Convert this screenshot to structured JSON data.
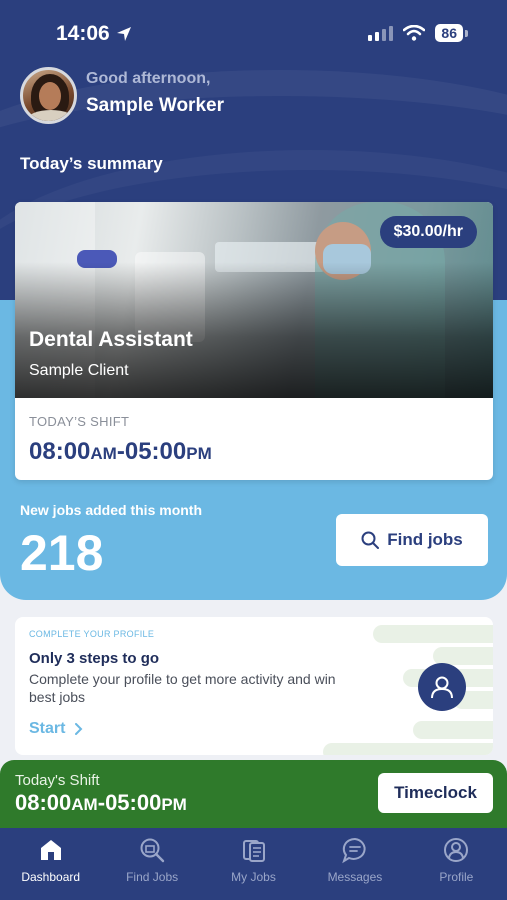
{
  "status_bar": {
    "time": "14:06",
    "battery": "86"
  },
  "header": {
    "greeting": "Good afternoon,",
    "user_name": "Sample Worker",
    "summary_title": "Today’s summary"
  },
  "job_card": {
    "rate": "$30.00/hr",
    "title": "Dental Assistant",
    "client": "Sample Client",
    "shift_label": "TODAY’S SHIFT",
    "shift_start": "08:00",
    "shift_start_ampm": "AM",
    "shift_separator": "-",
    "shift_end": "05:00",
    "shift_end_ampm": "PM"
  },
  "new_jobs": {
    "label": "New jobs added this month",
    "count": "218",
    "find_button": "Find jobs"
  },
  "profile_card": {
    "tag": "COMPLETE YOUR PROFILE",
    "title": "Only 3 steps to go",
    "description": "Complete your profile to get more activity and win best jobs",
    "start_label": "Start"
  },
  "shift_banner": {
    "label": "Today's Shift",
    "start": "08:00",
    "start_ampm": "AM",
    "separator": "-",
    "end": "05:00",
    "end_ampm": "PM",
    "button": "Timeclock"
  },
  "bottom_nav": {
    "items": [
      {
        "label": "Dashboard",
        "icon": "home-icon",
        "active": true
      },
      {
        "label": "Find Jobs",
        "icon": "find-jobs-icon",
        "active": false
      },
      {
        "label": "My Jobs",
        "icon": "my-jobs-icon",
        "active": false
      },
      {
        "label": "Messages",
        "icon": "messages-icon",
        "active": false
      },
      {
        "label": "Profile",
        "icon": "profile-icon",
        "active": false
      }
    ]
  },
  "colors": {
    "primary": "#2b3f7e",
    "light_blue": "#6bb8e3",
    "green": "#2f7a2b"
  }
}
